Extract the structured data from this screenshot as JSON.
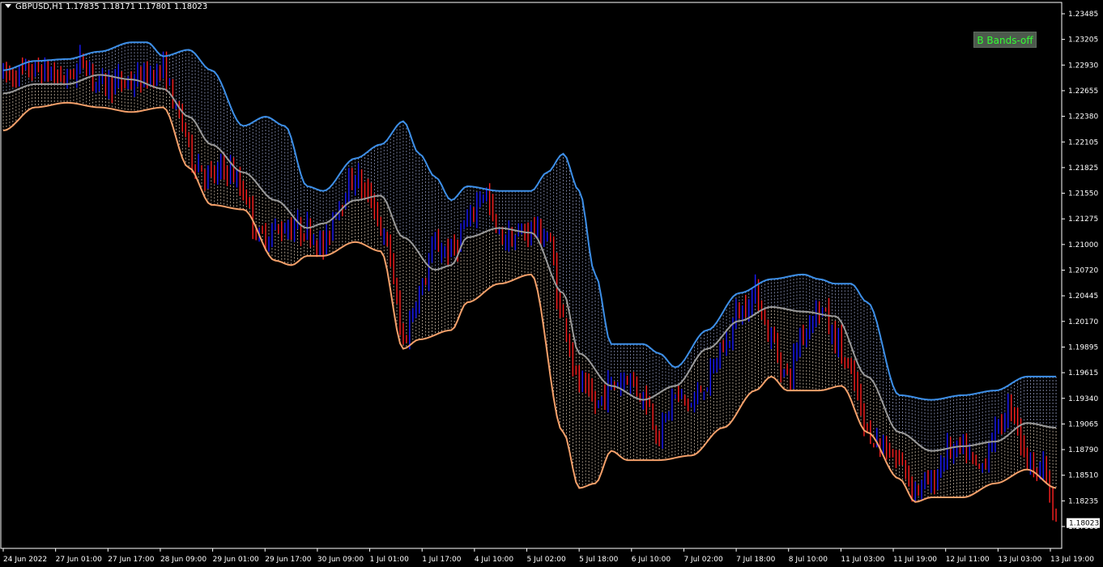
{
  "header": {
    "symbol_info": "GBPUSD,H1  1.17835 1.18171 1.17801 1.18023"
  },
  "button": {
    "label": "B Bands-off"
  },
  "colors": {
    "background": "#000000",
    "axis": "#ffffff",
    "upper_band": "#3d8fe8",
    "lower_band": "#f5a06a",
    "middle_band": "#9a9a9a",
    "upper_fill": "#aab4e0",
    "lower_fill": "#f0dcc4",
    "bull": "#1a1aff",
    "bear": "#ff2020",
    "price_tag_bg": "#ffffff"
  },
  "chart_data": {
    "type": "candlestick",
    "symbol": "GBPUSD",
    "timeframe": "H1",
    "ohlc_last": {
      "open": 1.17835,
      "high": 1.18171,
      "low": 1.17801,
      "close": 1.18023
    },
    "current_price_label": "1.18023",
    "ylim": [
      1.1775,
      1.2363
    ],
    "y_ticks": [
      "1.23485",
      "1.23205",
      "1.22930",
      "1.22655",
      "1.22380",
      "1.22105",
      "1.21825",
      "1.21550",
      "1.21275",
      "1.21000",
      "1.20720",
      "1.20445",
      "1.20170",
      "1.19895",
      "1.19615",
      "1.19340",
      "1.19065",
      "1.18790",
      "1.18510",
      "1.18235",
      "1.17960"
    ],
    "x_ticks": [
      "24 Jun 2022",
      "27 Jun 01:00",
      "27 Jun 17:00",
      "28 Jun 09:00",
      "29 Jun 01:00",
      "29 Jun 17:00",
      "30 Jun 09:00",
      "1 Jul 01:00",
      "1 Jul 17:00",
      "4 Jul 10:00",
      "5 Jul 02:00",
      "5 Jul 18:00",
      "6 Jul 10:00",
      "7 Jul 02:00",
      "7 Jul 18:00",
      "8 Jul 10:00",
      "11 Jul 03:00",
      "11 Jul 19:00",
      "12 Jul 11:00",
      "13 Jul 03:00",
      "13 Jul 19:00"
    ],
    "bars_total": 330,
    "close_keypoints": [
      [
        0,
        1.2285
      ],
      [
        10,
        1.229
      ],
      [
        20,
        1.2282
      ],
      [
        25,
        1.23
      ],
      [
        30,
        1.2275
      ],
      [
        40,
        1.2278
      ],
      [
        50,
        1.229
      ],
      [
        55,
        1.224
      ],
      [
        60,
        1.219
      ],
      [
        65,
        1.2175
      ],
      [
        70,
        1.2185
      ],
      [
        75,
        1.216
      ],
      [
        80,
        1.211
      ],
      [
        85,
        1.2118
      ],
      [
        90,
        1.2122
      ],
      [
        95,
        1.2118
      ],
      [
        100,
        1.21
      ],
      [
        105,
        1.215
      ],
      [
        110,
        1.2175
      ],
      [
        115,
        1.215
      ],
      [
        120,
        1.21
      ],
      [
        125,
        1.2
      ],
      [
        130,
        1.205
      ],
      [
        135,
        1.21
      ],
      [
        140,
        1.2095
      ],
      [
        145,
        1.2125
      ],
      [
        150,
        1.216
      ],
      [
        155,
        1.211
      ],
      [
        160,
        1.211
      ],
      [
        165,
        1.212
      ],
      [
        170,
        1.211
      ],
      [
        175,
        1.202
      ],
      [
        180,
        1.195
      ],
      [
        185,
        1.193
      ],
      [
        190,
        1.195
      ],
      [
        195,
        1.196
      ],
      [
        200,
        1.194
      ],
      [
        205,
        1.19
      ],
      [
        210,
        1.194
      ],
      [
        215,
        1.193
      ],
      [
        220,
        1.1955
      ],
      [
        225,
        1.199
      ],
      [
        230,
        1.203
      ],
      [
        235,
        1.205
      ],
      [
        240,
        1.2
      ],
      [
        245,
        1.196
      ],
      [
        250,
        1.201
      ],
      [
        255,
        1.2035
      ],
      [
        260,
        1.2
      ],
      [
        265,
        1.196
      ],
      [
        270,
        1.19
      ],
      [
        275,
        1.1885
      ],
      [
        280,
        1.187
      ],
      [
        285,
        1.184
      ],
      [
        290,
        1.1845
      ],
      [
        295,
        1.188
      ],
      [
        300,
        1.188
      ],
      [
        305,
        1.186
      ],
      [
        310,
        1.19
      ],
      [
        315,
        1.193
      ],
      [
        320,
        1.187
      ],
      [
        325,
        1.186
      ],
      [
        329,
        1.1802
      ]
    ],
    "upper_band_keypoints": [
      [
        0,
        1.229
      ],
      [
        10,
        1.23
      ],
      [
        20,
        1.2302
      ],
      [
        30,
        1.231
      ],
      [
        40,
        1.232
      ],
      [
        45,
        1.232
      ],
      [
        50,
        1.2305
      ],
      [
        58,
        1.2312
      ],
      [
        65,
        1.229
      ],
      [
        75,
        1.223
      ],
      [
        82,
        1.224
      ],
      [
        88,
        1.223
      ],
      [
        95,
        1.2165
      ],
      [
        100,
        1.216
      ],
      [
        110,
        1.2195
      ],
      [
        118,
        1.221
      ],
      [
        125,
        1.2235
      ],
      [
        130,
        1.22
      ],
      [
        135,
        1.2175
      ],
      [
        140,
        1.215
      ],
      [
        145,
        1.2165
      ],
      [
        155,
        1.216
      ],
      [
        165,
        1.216
      ],
      [
        170,
        1.218
      ],
      [
        175,
        1.22
      ],
      [
        180,
        1.216
      ],
      [
        185,
        1.207
      ],
      [
        190,
        1.1995
      ],
      [
        200,
        1.1995
      ],
      [
        205,
        1.1985
      ],
      [
        210,
        1.197
      ],
      [
        220,
        1.201
      ],
      [
        230,
        1.205
      ],
      [
        240,
        1.2065
      ],
      [
        250,
        1.207
      ],
      [
        255,
        1.2065
      ],
      [
        260,
        1.206
      ],
      [
        265,
        1.206
      ],
      [
        270,
        1.204
      ],
      [
        280,
        1.194
      ],
      [
        290,
        1.1935
      ],
      [
        300,
        1.194
      ],
      [
        310,
        1.1945
      ],
      [
        320,
        1.196
      ],
      [
        329,
        1.196
      ]
    ],
    "middle_band_keypoints": [
      [
        0,
        1.2265
      ],
      [
        10,
        1.2275
      ],
      [
        20,
        1.2275
      ],
      [
        30,
        1.2285
      ],
      [
        40,
        1.228
      ],
      [
        50,
        1.227
      ],
      [
        58,
        1.224
      ],
      [
        65,
        1.221
      ],
      [
        75,
        1.218
      ],
      [
        85,
        1.215
      ],
      [
        95,
        1.212
      ],
      [
        100,
        1.2125
      ],
      [
        110,
        1.215
      ],
      [
        118,
        1.2155
      ],
      [
        125,
        1.211
      ],
      [
        135,
        1.2075
      ],
      [
        140,
        1.208
      ],
      [
        145,
        1.211
      ],
      [
        155,
        1.212
      ],
      [
        165,
        1.2115
      ],
      [
        175,
        1.205
      ],
      [
        180,
        1.1985
      ],
      [
        190,
        1.195
      ],
      [
        200,
        1.1935
      ],
      [
        210,
        1.195
      ],
      [
        220,
        1.199
      ],
      [
        230,
        1.202
      ],
      [
        240,
        1.2035
      ],
      [
        250,
        1.203
      ],
      [
        260,
        1.2025
      ],
      [
        270,
        1.196
      ],
      [
        280,
        1.19
      ],
      [
        290,
        1.188
      ],
      [
        300,
        1.1885
      ],
      [
        310,
        1.189
      ],
      [
        320,
        1.191
      ],
      [
        329,
        1.1905
      ]
    ],
    "lower_band_keypoints": [
      [
        0,
        1.2225
      ],
      [
        10,
        1.225
      ],
      [
        20,
        1.2255
      ],
      [
        30,
        1.225
      ],
      [
        40,
        1.2245
      ],
      [
        50,
        1.225
      ],
      [
        58,
        1.2185
      ],
      [
        65,
        1.2145
      ],
      [
        75,
        1.214
      ],
      [
        85,
        1.2085
      ],
      [
        90,
        1.208
      ],
      [
        95,
        1.209
      ],
      [
        100,
        1.209
      ],
      [
        110,
        1.2105
      ],
      [
        118,
        1.2095
      ],
      [
        125,
        1.199
      ],
      [
        130,
        1.2
      ],
      [
        140,
        1.201
      ],
      [
        145,
        1.204
      ],
      [
        155,
        1.206
      ],
      [
        165,
        1.207
      ],
      [
        175,
        1.19
      ],
      [
        180,
        1.184
      ],
      [
        185,
        1.1845
      ],
      [
        190,
        1.188
      ],
      [
        195,
        1.187
      ],
      [
        205,
        1.187
      ],
      [
        215,
        1.1875
      ],
      [
        225,
        1.1905
      ],
      [
        235,
        1.1945
      ],
      [
        240,
        1.196
      ],
      [
        245,
        1.1945
      ],
      [
        255,
        1.1945
      ],
      [
        262,
        1.195
      ],
      [
        270,
        1.19
      ],
      [
        280,
        1.185
      ],
      [
        285,
        1.1825
      ],
      [
        290,
        1.183
      ],
      [
        300,
        1.183
      ],
      [
        310,
        1.1845
      ],
      [
        320,
        1.186
      ],
      [
        329,
        1.184
      ]
    ]
  }
}
